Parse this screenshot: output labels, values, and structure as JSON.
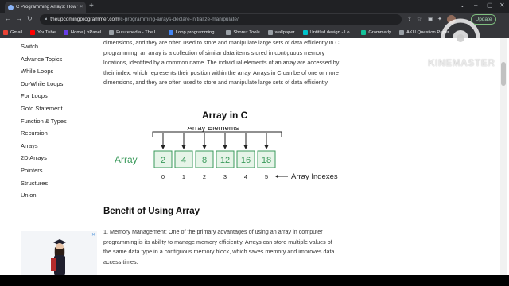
{
  "browser": {
    "tab_title": "C Programming Arrays: How to D",
    "tab_close": "×",
    "new_tab": "+",
    "url_host": "theupcomingprogrammer.com",
    "url_path": "/c-programming-arrays-declare-initialize-manipulate/",
    "update_label": "Update"
  },
  "bookmarks": [
    {
      "label": "Gmail",
      "color": "#ea4335"
    },
    {
      "label": "YouTube",
      "color": "#ff0000"
    },
    {
      "label": "Home | hPanel",
      "color": "#673de6"
    },
    {
      "label": "Futurepedia - The L...",
      "color": "#9aa0a6"
    },
    {
      "label": "Loop programming...",
      "color": "#4285f4"
    },
    {
      "label": "Shorez Tools",
      "color": "#9aa0a6"
    },
    {
      "label": "wallpaper",
      "color": "#9aa0a6"
    },
    {
      "label": "Untitled design - Lo...",
      "color": "#00c4cc"
    },
    {
      "label": "Grammarly",
      "color": "#15c39a"
    },
    {
      "label": "AKU Question Paper",
      "color": "#9aa0a6"
    }
  ],
  "sidebar": {
    "items": [
      "Switch",
      "Advance Topics",
      "While Loops",
      "Do-While Loops",
      "For Loops",
      "Goto Statement",
      "Function & Types",
      "Recursion",
      "Arrays",
      "2D Arrays",
      "Pointers",
      "Structures",
      "Union"
    ]
  },
  "article": {
    "para1_lines": [
      "dimensions, and they are often used to store and manipulate large sets of data efficiently.In C",
      "programming, an array is a collection of similar data items stored in contiguous memory",
      "locations, identified by a common name. The individual elements of an array are accessed by",
      "their index, which represents their position within the array. Arrays in C can be of one or more",
      "dimensions, and they are often used to store and manipulate large sets of data efficiently."
    ],
    "figure": {
      "title": "Array in C",
      "elements_label": "Array Elements",
      "array_label": "Array",
      "values": [
        "2",
        "4",
        "8",
        "12",
        "16",
        "18"
      ],
      "indexes": [
        "0",
        "1",
        "2",
        "3",
        "4",
        "5"
      ],
      "indexes_label": "Array Indexes",
      "color": "#3a9a5b"
    },
    "heading2": "Benefit of Using Array",
    "para2_lines": [
      "1. Memory Management: One of the primary advantages of using an array in computer",
      "programming is its ability to manage memory efficiently. Arrays can store multiple values of",
      "the same data type in a contiguous memory block, which saves memory and improves data",
      "access times."
    ]
  },
  "ad": {
    "close": "✕"
  },
  "watermark": {
    "text": "KINEMASTER"
  }
}
